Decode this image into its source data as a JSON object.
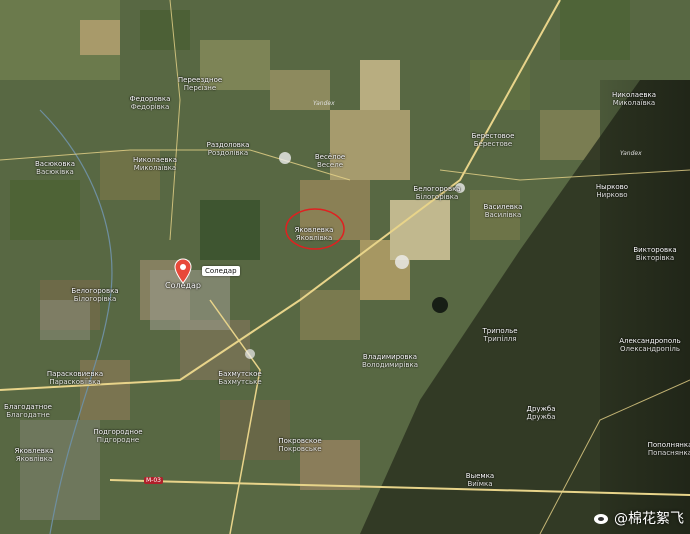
{
  "map": {
    "places": [
      {
        "name": "Переездное",
        "sub": "Перєїзне"
      },
      {
        "name": "Федоровка",
        "sub": "Федорівка"
      },
      {
        "name": "Васюковка",
        "sub": "Васюківка"
      },
      {
        "name": "Николаевка",
        "sub": "Миколаївка"
      },
      {
        "name": "Раздоловка",
        "sub": "Роздолівка"
      },
      {
        "name": "Весёлое",
        "sub": "Веселе"
      },
      {
        "name": "Берестовое",
        "sub": "Берестове"
      },
      {
        "name": "Белогоровка",
        "sub": "Білогорівка"
      },
      {
        "name": "Василевка",
        "sub": "Василівка"
      },
      {
        "name": "Нырково",
        "sub": "Нирково"
      },
      {
        "name": "Николаевка",
        "sub": "Миколаївка"
      },
      {
        "name": "Яковлевка",
        "sub": "Яковлівка"
      },
      {
        "name": "Викторовка",
        "sub": "Вікторівка"
      },
      {
        "name": "Белогоровка",
        "sub": "Білогорівка"
      },
      {
        "name": "Триполье",
        "sub": "Трипілля"
      },
      {
        "name": "Александрополь",
        "sub": "Олександропіль"
      },
      {
        "name": "Владимировка",
        "sub": "Володимирівка"
      },
      {
        "name": "Парасковиевка",
        "sub": "Парасковіївка"
      },
      {
        "name": "Бахмутское",
        "sub": "Бахмутське"
      },
      {
        "name": "Благодатное",
        "sub": "Благодатне"
      },
      {
        "name": "Подгородное",
        "sub": "Підгородне"
      },
      {
        "name": "Дружба",
        "sub": "Дружба"
      },
      {
        "name": "Покровское",
        "sub": "Покровське"
      },
      {
        "name": "Яковлевка",
        "sub": "Яковлівка"
      },
      {
        "name": "Выемка",
        "sub": "Виїмка"
      },
      {
        "name": "Пополнянка",
        "sub": "Попаснянка"
      }
    ],
    "pin": {
      "label": "Соледар",
      "city_name": "Соледар",
      "color": "#e8493a"
    },
    "highlight": {
      "color": "#e02020"
    },
    "road_tag": "М-03",
    "provider_marks": [
      "Yandex",
      "Yandex"
    ],
    "colors": {
      "road": "#e8d48a",
      "river": "#6e8fa0"
    }
  },
  "watermark": {
    "text": "@棉花絮飞"
  }
}
